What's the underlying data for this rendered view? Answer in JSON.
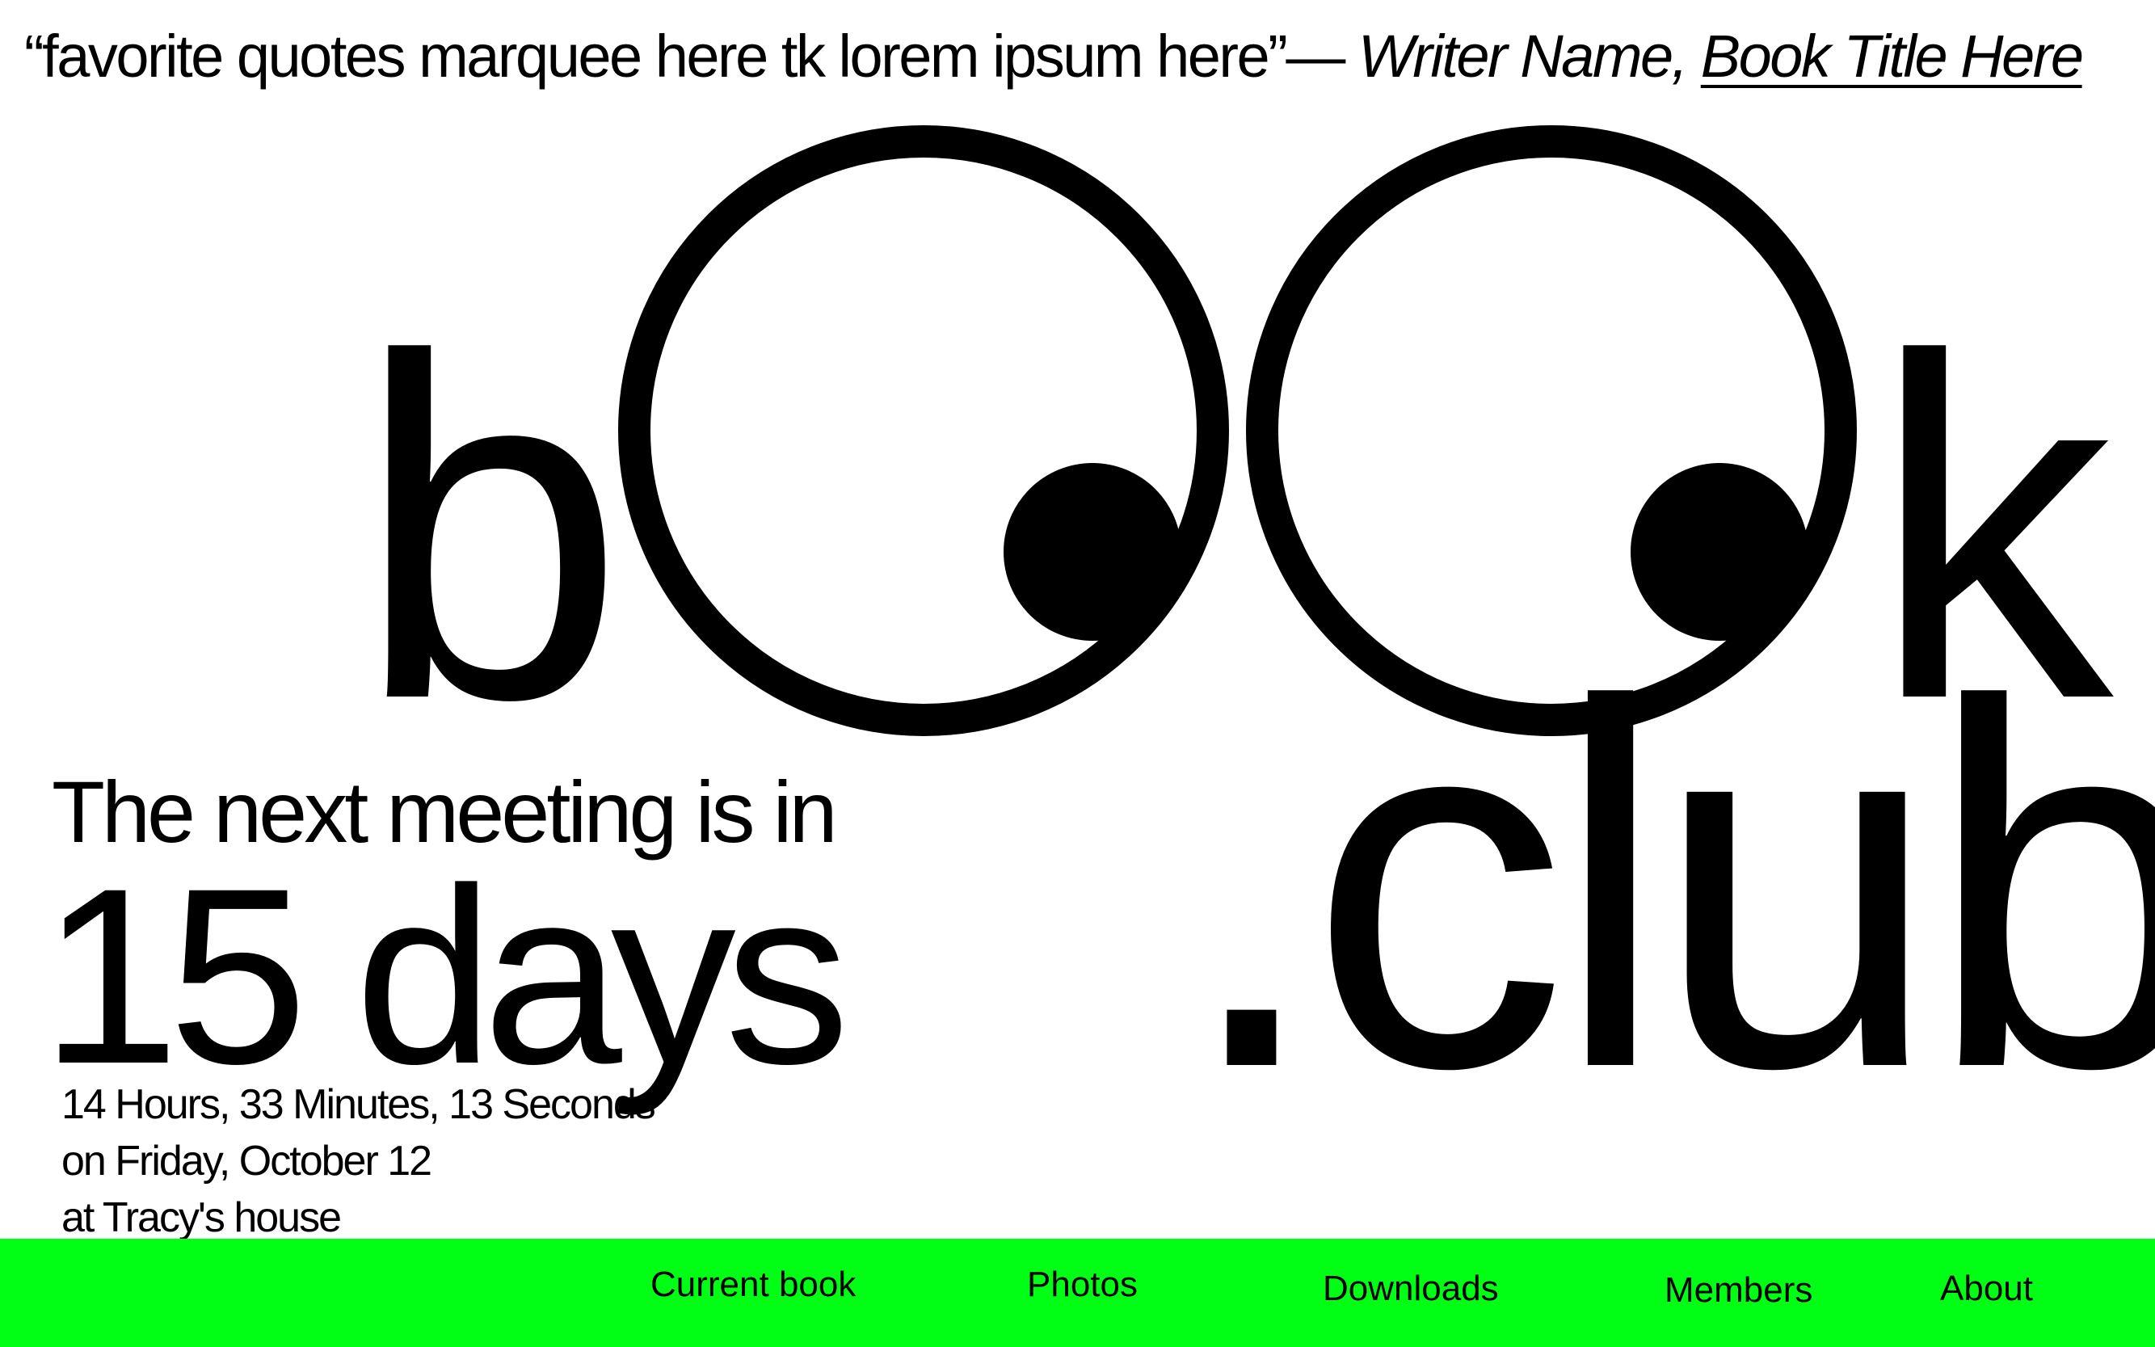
{
  "marquee": {
    "quote": "“favorite quotes marquee here tk lorem ipsum here”",
    "dash": "— ",
    "author": "Writer Name, ",
    "book_title": "Book Title Here"
  },
  "logo": {
    "letter_b": "b",
    "letter_k": "k",
    "club": ".club"
  },
  "countdown": {
    "label": "The next meeting is in",
    "days": "15 days",
    "time_remaining": "14 Hours, 33 Minutes, 13 Seconds",
    "date": "on Friday, October 12",
    "location": "at Tracy's house"
  },
  "nav": {
    "items": [
      {
        "label": "Current book"
      },
      {
        "label": "Photos"
      },
      {
        "label": "Downloads"
      },
      {
        "label": "Members"
      },
      {
        "label": "About"
      }
    ]
  },
  "colors": {
    "nav_background": "#00ff14",
    "text": "#000000",
    "background": "#ffffff"
  }
}
